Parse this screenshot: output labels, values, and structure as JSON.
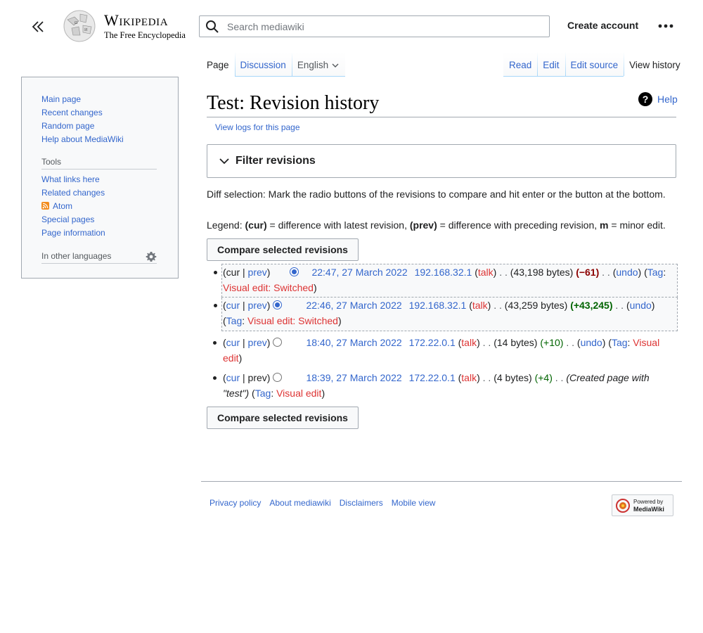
{
  "header": {
    "wordmark_title": "Wikipedia",
    "wordmark_tagline": "The Free Encyclopedia",
    "search_placeholder": "Search mediawiki",
    "create_account": "Create account"
  },
  "tabs": {
    "left": [
      {
        "label": "Page",
        "selected": true
      },
      {
        "label": "Discussion",
        "selected": false
      }
    ],
    "language": "English",
    "right": [
      {
        "label": "Read",
        "selected": false
      },
      {
        "label": "Edit",
        "selected": false
      },
      {
        "label": "Edit source",
        "selected": false
      },
      {
        "label": "View history",
        "selected": true
      }
    ]
  },
  "sidebar": {
    "navigation": [
      "Main page",
      "Recent changes",
      "Random page",
      "Help about MediaWiki"
    ],
    "tools_heading": "Tools",
    "tools": [
      "What links here",
      "Related changes",
      "Atom",
      "Special pages",
      "Page information"
    ],
    "other_languages": "In other languages"
  },
  "content": {
    "title": "Test: Revision history",
    "help": "Help",
    "view_logs": "View logs for this page",
    "filter": "Filter revisions",
    "diff_selection": "Diff selection: Mark the radio buttons of the revisions to compare and hit enter or the button at the bottom.",
    "legend_prefix": "Legend: ",
    "legend_cur": "(cur)",
    "legend_cur_desc": " = difference with latest revision, ",
    "legend_prev": "(prev)",
    "legend_prev_desc": " = difference with preceding revision, ",
    "legend_m": "m",
    "legend_m_desc": " = minor edit.",
    "compare_button": "Compare selected revisions"
  },
  "revisions": [
    {
      "cur": "cur",
      "prev": "prev",
      "date": "22:47, 27 March 2022",
      "user": "192.168.32.1",
      "talk": "talk",
      "bytes": "(43,198 bytes)",
      "change": "(−61)",
      "undo": "undo",
      "tag_label": "Tag",
      "tag": "Visual edit: Switched",
      "radio_selected": true,
      "cur_link": false,
      "prev_link": true
    },
    {
      "cur": "cur",
      "prev": "prev",
      "date": "22:46, 27 March 2022",
      "user": "192.168.32.1",
      "talk": "talk",
      "bytes": "(43,259 bytes)",
      "change": "(+43,245)",
      "undo": "undo",
      "tag_label": "Tag",
      "tag": "Visual edit: Switched",
      "radio_selected": true,
      "cur_link": true,
      "prev_link": true
    },
    {
      "cur": "cur",
      "prev": "prev",
      "date": "18:40, 27 March 2022",
      "user": "172.22.0.1",
      "talk": "talk",
      "bytes": "(14 bytes)",
      "change": "(+10)",
      "undo": "undo",
      "tag_label": "Tag",
      "tag": "Visual edit",
      "radio_selected": false,
      "cur_link": true,
      "prev_link": true
    },
    {
      "cur": "cur",
      "prev": "prev",
      "date": "18:39, 27 March 2022",
      "user": "172.22.0.1",
      "talk": "talk",
      "bytes": "(4 bytes)",
      "change": "(+4)",
      "comment": "(Created page with \"test\")",
      "tag_label": "Tag",
      "tag": "Visual edit",
      "radio_selected": false,
      "cur_link": true,
      "prev_link": false
    }
  ],
  "footer": {
    "links": [
      "Privacy policy",
      "About mediawiki",
      "Disclaimers",
      "Mobile view"
    ],
    "powered_line1": "Powered by",
    "powered_line2": "MediaWiki"
  },
  "colors": {
    "link": "#3366cc",
    "redlink": "#dd3333",
    "negative": "#8b0000",
    "positive": "#006400"
  }
}
